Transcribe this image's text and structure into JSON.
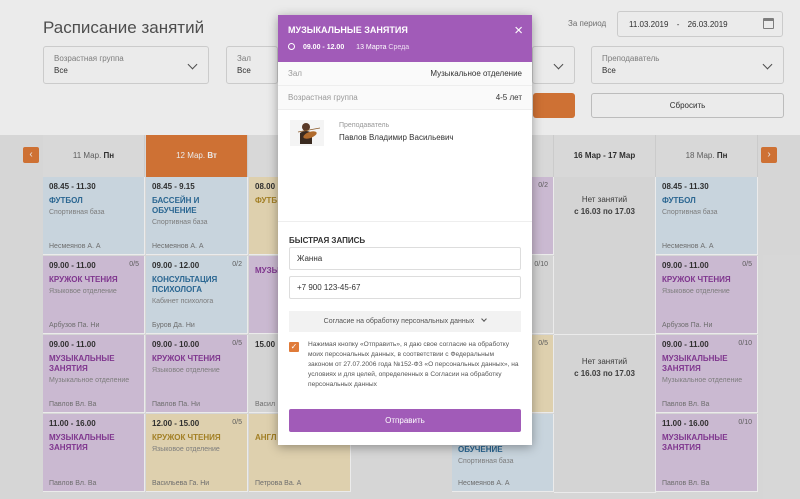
{
  "header": {
    "title": "Расписание занятий",
    "period_label": "За период",
    "date_from": "11.03.2019",
    "date_sep": "-",
    "date_to": "26.03.2019"
  },
  "filters": [
    {
      "label": "Возрастная группа",
      "value": "Все"
    },
    {
      "label": "Зал",
      "value": "Все"
    },
    {
      "label": "Преподаватель",
      "value": "Все"
    }
  ],
  "reset_label": "Сбросить",
  "nav": {
    "prev": "‹",
    "next": "›"
  },
  "days": [
    {
      "num": "11",
      "mon": "Мар.",
      "dow": "Пн"
    },
    {
      "num": "12",
      "mon": "Мар.",
      "dow": "Вт"
    },
    {
      "weekend": "16 Мар - 17 Мар"
    },
    {
      "num": "18",
      "mon": "Мар.",
      "dow": "Пн"
    }
  ],
  "col1": [
    {
      "time": "08.45 - 11.30",
      "name": "ФУТБОЛ",
      "place": "Спортивная база",
      "teacher": "Несмеянов А. А"
    },
    {
      "time": "09.00 - 11.00",
      "name": "КРУЖОК ЧТЕНИЯ",
      "place": "Языковое отделение",
      "teacher": "Арбузов Па. Ни",
      "cnt": "0/5"
    },
    {
      "time": "09.00 - 11.00",
      "name": "МУЗЫКАЛЬНЫЕ ЗАНЯТИЯ",
      "place": "Музыкальное отделение",
      "teacher": "Павлов Вл. Ва"
    },
    {
      "time": "11.00 - 16.00",
      "name": "МУЗЫКАЛЬНЫЕ ЗАНЯТИЯ",
      "place": "",
      "teacher": "Павлов Вл. Ва"
    }
  ],
  "col2": [
    {
      "time": "08.45 - 9.15",
      "name": "БАССЕЙН И ОБУЧЕНИЕ",
      "place": "Спортивная база",
      "teacher": "Несмеянов А. А"
    },
    {
      "time": "09.00 - 12.00",
      "name": "КОНСУЛЬТАЦИЯ ПСИХОЛОГА",
      "place": "Кабинет психолога",
      "teacher": "Буров Да. Ни",
      "cnt": "0/2"
    },
    {
      "time": "09.00 - 10.00",
      "name": "КРУЖОК ЧТЕНИЯ",
      "place": "Языковое отделение",
      "teacher": "Павлов Па. Ни",
      "cnt": "0/5"
    },
    {
      "time": "12.00 - 15.00",
      "name": "КРУЖОК ЧТЕНИЯ",
      "place": "Языковое отделение",
      "teacher": "Васильева Га. Ни",
      "cnt": "0/5"
    }
  ],
  "col3_fragments": {
    "a": "08.00",
    "b": "ФУТБ",
    "c": "МУЗЫ",
    "d": "15.00",
    "e": "АНГЛ",
    "f": "Васил",
    "g": "Петрова Ва. А"
  },
  "col5_fragments": {
    "teacher": "Малышева М. А",
    "cnt1": "0/2",
    "cnt2": "0/10",
    "cnt3": "0/5",
    "name": "ОБУЧЕНИЕ",
    "place": "Спортивная база",
    "teacher2": "Несмеянов А. А",
    "pre": "Языковое отделение"
  },
  "weekend_text": {
    "title": "Нет занятий",
    "range": "с 16.03 по 17.03"
  },
  "col7": [
    {
      "time": "08.45 - 11.30",
      "name": "ФУТБОЛ",
      "place": "Спортивная база",
      "teacher": "Несмеянов А. А"
    },
    {
      "time": "09.00 - 11.00",
      "name": "КРУЖОК ЧТЕНИЯ",
      "place": "Языковое отделение",
      "teacher": "Арбузов Па. Ни",
      "cnt": "0/5"
    },
    {
      "time": "09.00 - 11.00",
      "name": "МУЗЫКАЛЬНЫЕ ЗАНЯТИЯ",
      "place": "Музыкальное отделение",
      "teacher": "Павлов Вл. Ва",
      "cnt": "0/10"
    },
    {
      "time": "11.00 - 16.00",
      "name": "МУЗЫКАЛЬНЫЕ ЗАНЯТИЯ",
      "place": "",
      "teacher": "Павлов Вл. Ва",
      "cnt": "0/10"
    }
  ],
  "modal": {
    "title": "МУЗЫКАЛЬНЫЕ ЗАНЯТИЯ",
    "time": "09.00 - 12.00",
    "date": "13 Марта",
    "day": "Среда",
    "hall_label": "Зал",
    "hall_value": "Музыкальное отделение",
    "age_label": "Возрастная группа",
    "age_value": "4-5 лет",
    "teacher_label": "Преподаватель",
    "teacher_name": "Павлов Владимир Васильевич",
    "quick_title": "БЫСТРАЯ ЗАПИСЬ",
    "name_value": "Жанна",
    "phone_value": "+7 900 123-45-67",
    "consent_dropdown": "Согласие на обработку персональных данных",
    "consent_text": "Нажимая кнопку «Отправить», я даю свое согласие на обработку моих персональных данных, в соответствии с Федеральным законом от 27.07.2006 года №152-ФЗ «О персональных данных», на условиях и для целей, определенных в Согласии на обработку персональных данных",
    "submit_label": "Отправить",
    "close_label": "×",
    "check_mark": "✓"
  },
  "colors": {
    "accent": "#e07b39",
    "purple": "#a15bb8"
  }
}
